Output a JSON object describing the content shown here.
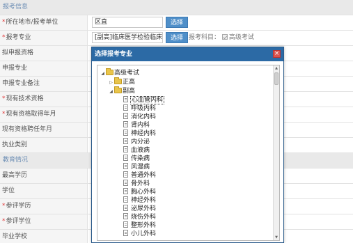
{
  "form": {
    "section_apply": "报考信息",
    "region_label": "所在地市/报考单位",
    "region_value": "区直",
    "region_btn": "选择",
    "major_label": "报考专业",
    "major_value": "[副高]临床医学检验临床",
    "major_btn": "选择",
    "subject_label": "报考科目：",
    "subject_check": "高级考试",
    "r3": "拟申报资格",
    "r4": "申报专业",
    "r5": "申报专业备注",
    "r6": "现有技术资格",
    "r7": "现有资格取得年月",
    "r8": "现有资格聘任年月",
    "r9": "执业类别",
    "section_edu": "教育情况",
    "e1": "最高学历",
    "e2": "学位",
    "e3": "参评学历",
    "e4": "参评学位",
    "e5": "毕业学校",
    "e6": "毕业时间",
    "e7": "毕业专业"
  },
  "dialog": {
    "title": "选择报考专业",
    "close": "×",
    "root": "高级考试",
    "folder1": "正高",
    "folder2": "副高",
    "items": [
      "心血管内科",
      "呼吸内科",
      "消化内科",
      "肾内科",
      "神经内科",
      "内分泌",
      "血液病",
      "传染病",
      "风湿病",
      "普通外科",
      "骨外科",
      "胸心外科",
      "神经外科",
      "泌尿外科",
      "烧伤外科",
      "整形外科",
      "小儿外科"
    ]
  }
}
